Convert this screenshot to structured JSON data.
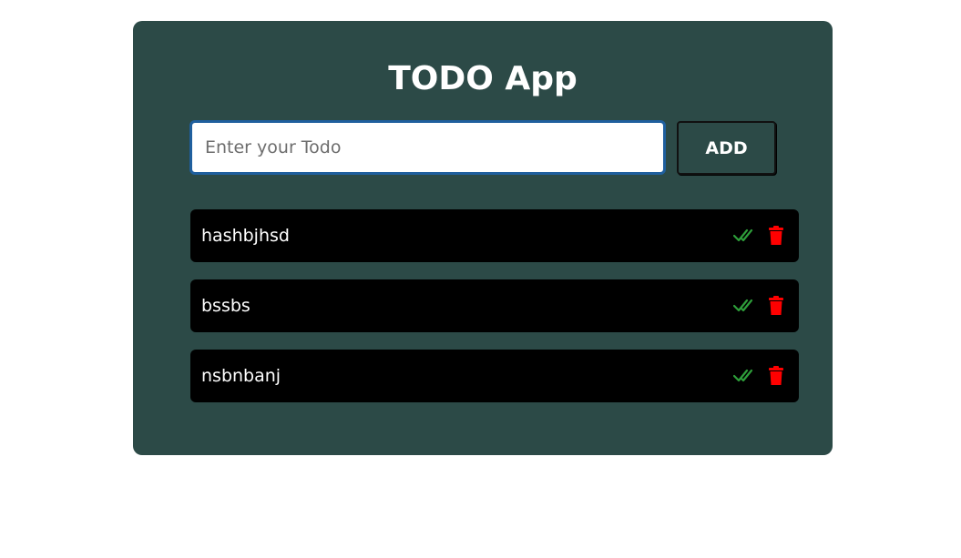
{
  "app": {
    "title": "TODO App"
  },
  "input": {
    "placeholder": "Enter your Todo",
    "value": ""
  },
  "add_button": {
    "label": "ADD"
  },
  "todos": [
    {
      "text": "hashbjhsd"
    },
    {
      "text": "bssbs"
    },
    {
      "text": "nsbnbanj"
    }
  ],
  "icons": {
    "complete": "double-check-icon",
    "delete": "trash-icon"
  },
  "colors": {
    "card_bg": "#2c4a47",
    "item_bg": "#000000",
    "check": "#2e9e3a",
    "delete": "#ff0000",
    "input_border": "#1f5f9e"
  }
}
